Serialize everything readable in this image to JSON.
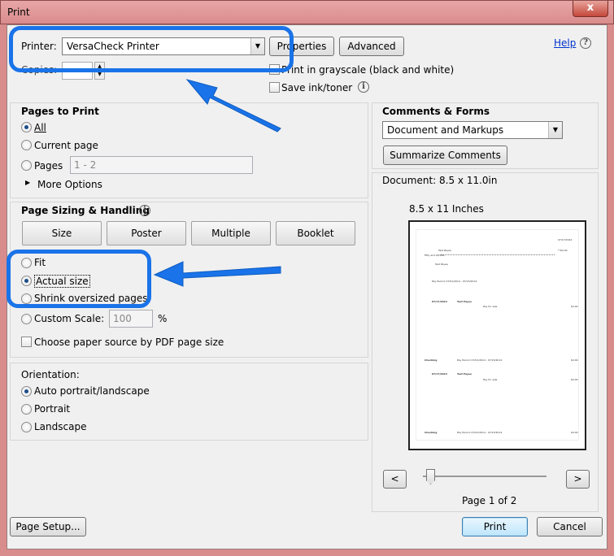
{
  "window": {
    "title": "Print",
    "close_glyph": "x"
  },
  "top": {
    "printer_label": "Printer:",
    "printer_value": "VersaCheck Printer",
    "properties_label": "Properties",
    "advanced_label": "Advanced",
    "help_label": "Help",
    "copies_label": "Copies:",
    "grayscale_label": "Print in grayscale (black and white)",
    "save_ink_label": "Save ink/toner"
  },
  "pages_to_print": {
    "heading": "Pages to Print",
    "all_label": "All",
    "current_label": "Current page",
    "pages_label": "Pages",
    "pages_value": "1 - 2",
    "more_options_label": "More Options"
  },
  "sizing": {
    "heading": "Page Sizing & Handling",
    "tabs": [
      "Size",
      "Poster",
      "Multiple",
      "Booklet"
    ],
    "fit_label": "Fit",
    "actual_label": "Actual size",
    "shrink_label": "Shrink oversized pages",
    "custom_label": "Custom Scale:",
    "custom_value": "100",
    "percent": "%",
    "paper_source_label": "Choose paper source by PDF page size"
  },
  "orientation": {
    "heading": "Orientation:",
    "auto_label": "Auto portrait/landscape",
    "portrait_label": "Portrait",
    "landscape_label": "Landscape"
  },
  "comments": {
    "heading": "Comments & Forms",
    "select_value": "Document and Markups",
    "summarize_label": "Summarize Comments"
  },
  "preview": {
    "document_size": "Document: 8.5 x 11.0in",
    "paper_label": "8.5 x 11 Inches",
    "page_indicator": "Page 1 of 2",
    "prev_label": "<",
    "next_label": ">",
    "check_texts": {
      "date1": "07/17/2014",
      "payee_top": "Test Payee",
      "amount_top": "**$0.00",
      "pay_line": "Fifty and 00/100",
      "payee2": "Test Payee",
      "pay_period": "Pay Period: 07/01/2014 - 07/15/2014",
      "stub_date": "07/17/2014",
      "stub_payee": "Test Payee",
      "pay_for_sale": "Pay for sale",
      "stub_amount": "$0.00",
      "checking": "Checking",
      "checking_period": "Pay Period: 07/01/2014 - 07/15/2014",
      "checking_amount": "$0.00",
      "stub2_date": "07/17/2014",
      "stub2_payee": "Test Payee",
      "stub2_for": "Pay for sale",
      "stub2_amount": "$0.00",
      "checking2": "Checking",
      "checking2_period": "Pay Period: 07/01/2014 - 07/15/2014",
      "checking2_amount": "$0.00"
    }
  },
  "bottom": {
    "page_setup_label": "Page Setup...",
    "print_label": "Print",
    "cancel_label": "Cancel"
  },
  "colors": {
    "highlight": "#1a73e8",
    "title_bar": "#d98c8c"
  }
}
